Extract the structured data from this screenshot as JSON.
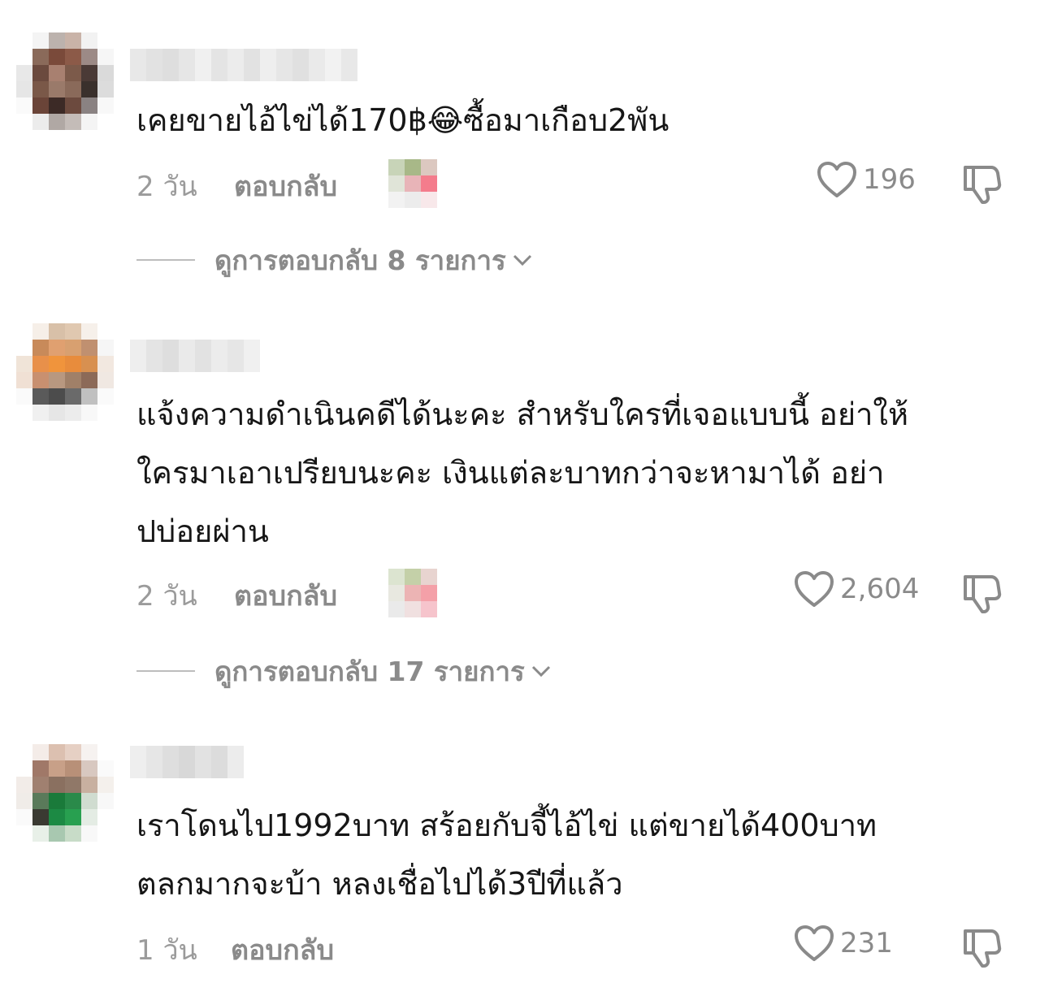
{
  "comments": [
    {
      "text": "เคยขายไอ้ไข่ได้170฿😂ซื้อมาเกือบ2พัน",
      "time": "2 วัน",
      "reply_label": "ตอบกลับ",
      "like_count": "196",
      "has_sticker": true,
      "view_replies": "ดูการตอบกลับ 8 รายการ"
    },
    {
      "text": "แจ้งความดำเนินคดีได้นะคะ สำหรับใครที่เจอแบบนี้ อย่าให้\nใครมาเอาเปรียบนะคะ เงินแต่ละบาทกว่าจะหามาได้ อย่า\nปบ่อยผ่าน",
      "time": "2 วัน",
      "reply_label": "ตอบกลับ",
      "like_count": "2,604",
      "has_sticker": true,
      "view_replies": "ดูการตอบกลับ 17 รายการ"
    },
    {
      "text": "เราโดนไป1992บาท สร้อยกับจี้ไอ้ไข่ แต่ขายได้400บาท\nตลกมากจะบ้า หลงเชื่อไปได้3ปีที่แล้ว",
      "time": "1 วัน",
      "reply_label": "ตอบกลับ",
      "like_count": "231",
      "has_sticker": false
    }
  ],
  "colors": {
    "text": "#161616",
    "meta_gray": "#8a8a8a",
    "time_gray": "#9b9b9b"
  },
  "icons": {
    "like": "heart-outline-icon",
    "dislike": "thumbs-down-icon",
    "expand": "chevron-down-icon"
  }
}
